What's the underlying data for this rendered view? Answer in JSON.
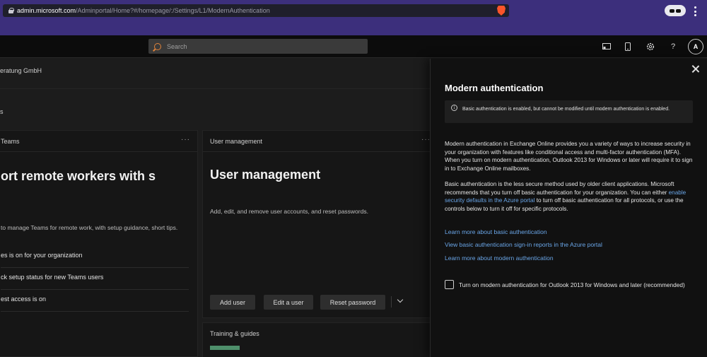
{
  "browser": {
    "url_host": "admin.microsoft.com",
    "url_path": "/Adminportal/Home?#/homepage/:/Settings/L1/ModernAuthentication"
  },
  "header": {
    "search_placeholder": "Search",
    "avatar_initial": "A",
    "help_label": "?"
  },
  "background": {
    "org_name": "eratung GmbH",
    "breadcrumb": "s",
    "teams_card": {
      "heading": "Teams",
      "title": "ort remote workers with s",
      "description": "to manage Teams for remote work, with setup guidance, short tips.",
      "rows": [
        "es is on for your organization",
        "ck setup status for new Teams users",
        "est access is on"
      ]
    },
    "user_card": {
      "heading": "User management",
      "title": "User management",
      "description": "Add, edit, and remove user accounts, and reset passwords.",
      "buttons": [
        "Add user",
        "Edit a user",
        "Reset password"
      ]
    },
    "training_card": {
      "heading": "Training & guides"
    }
  },
  "panel": {
    "title": "Modern authentication",
    "info": "Basic authentication is enabled, but cannot be modified until modern authentication is enabled.",
    "paragraph1": "Modern authentication in Exchange Online provides you a variety of ways to increase security in your organization with features like conditional access and multi-factor authentication (MFA). When you turn on modern authentication, Outlook 2013 for Windows or later will require it to sign in to Exchange Online mailboxes.",
    "paragraph2_a": "Basic authentication is the less secure method used by older client applications. Microsoft recommends that you turn off basic authentication for your organization. You can either ",
    "paragraph2_link": "enable security defaults in the Azure portal",
    "paragraph2_b": " to turn off basic authentication for all protocols, or use the controls below to turn it off for specific protocols.",
    "links": [
      "Learn more about basic authentication",
      "View basic authentication sign-in reports in the Azure portal",
      "Learn more about modern authentication"
    ],
    "checkbox_label": "Turn on modern authentication for Outlook 2013 for Windows and later (recommended)",
    "checkbox_checked": false
  }
}
